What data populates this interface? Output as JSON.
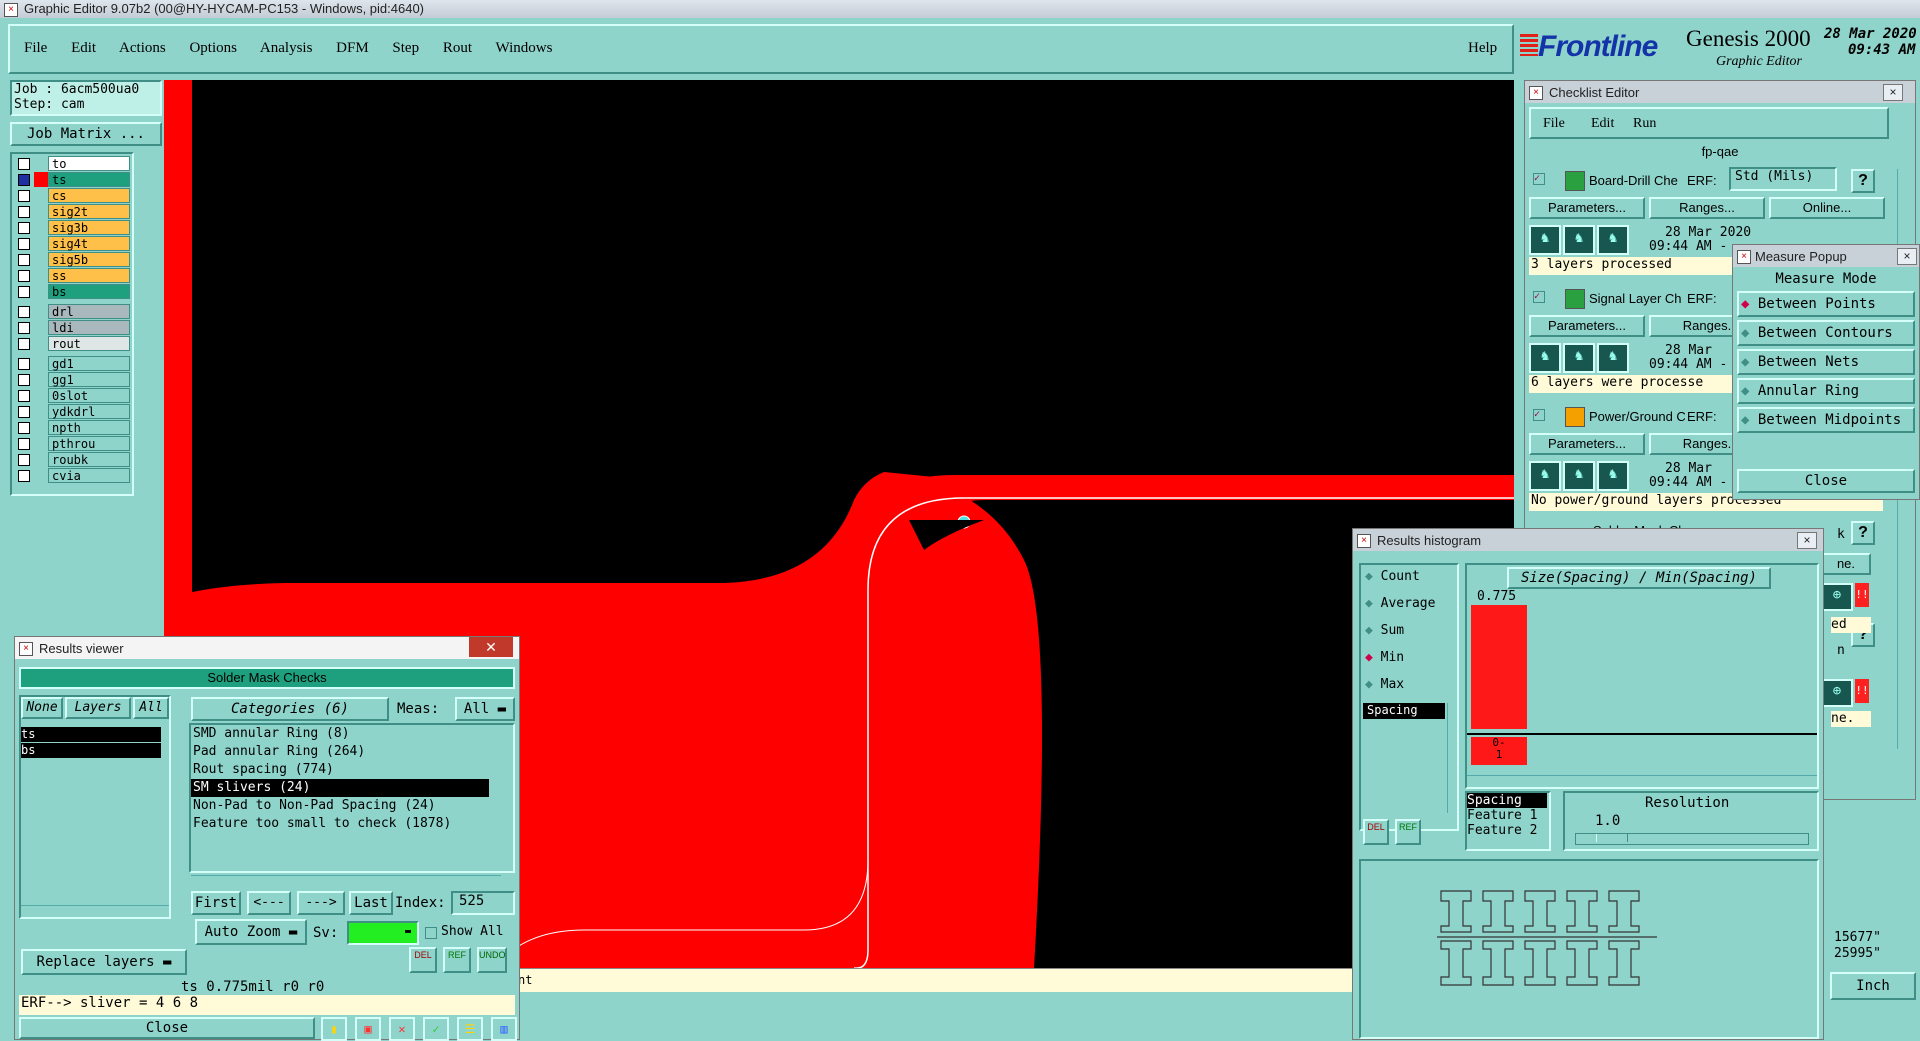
{
  "window": {
    "title": "Graphic Editor 9.07b2 (00@HY-HYCAM-PC153 - Windows, pid:4640)"
  },
  "menubar": {
    "items": [
      "File",
      "Edit",
      "Actions",
      "Options",
      "Analysis",
      "DFM",
      "Step",
      "Rout",
      "Windows"
    ],
    "help": "Help"
  },
  "brand": {
    "logo": "Frontline",
    "product": "Genesis 2000",
    "subtitle": "Graphic Editor",
    "date": "28 Mar 2020",
    "time": "09:43 AM"
  },
  "job": {
    "job_label": "Job : 6acm500ua0",
    "step_label": "Step: cam",
    "matrix_button": "Job Matrix ..."
  },
  "layers": [
    {
      "name": "to",
      "color": "#ffffff"
    },
    {
      "name": "ts",
      "color": "#1ea07e",
      "active": true
    },
    {
      "name": "cs",
      "color": "#ffc04a"
    },
    {
      "name": "sig2t",
      "color": "#ffc04a"
    },
    {
      "name": "sig3b",
      "color": "#ffc04a"
    },
    {
      "name": "sig4t",
      "color": "#ffc04a"
    },
    {
      "name": "sig5b",
      "color": "#ffc04a"
    },
    {
      "name": "ss",
      "color": "#ffc04a"
    },
    {
      "name": "bs",
      "color": "#1ea07e"
    },
    {
      "name": "drl",
      "color": "#a8b8bc"
    },
    {
      "name": "ldi",
      "color": "#a8b8bc"
    },
    {
      "name": "rout",
      "color": "#dfe6e6"
    },
    {
      "name": "gd1",
      "color": "#8fd4cb"
    },
    {
      "name": "gg1",
      "color": "#8fd4cb"
    },
    {
      "name": "0slot",
      "color": "#8fd4cb"
    },
    {
      "name": "ydkdrl",
      "color": "#8fd4cb"
    },
    {
      "name": "npth",
      "color": "#8fd4cb"
    },
    {
      "name": "pthrou",
      "color": "#8fd4cb"
    },
    {
      "name": "roubk",
      "color": "#8fd4cb"
    },
    {
      "name": "cvia",
      "color": "#8fd4cb"
    }
  ],
  "results_viewer": {
    "title": "Results viewer",
    "heading": "Solder Mask Checks",
    "tabs": {
      "none": "None",
      "layers": "Layers",
      "all": "All"
    },
    "categories_label": "Categories (6)",
    "meas_label": "Meas:",
    "meas_value": "All",
    "layer_list": [
      "ts",
      "bs"
    ],
    "categories": [
      "SMD annular Ring (8)",
      "Pad annular Ring (264)",
      "Rout spacing (774)",
      "SM slivers (24)",
      "Non-Pad to Non-Pad Spacing (24)",
      "Feature too small to check (1878)"
    ],
    "selected_category": 3,
    "nav": {
      "first": "First",
      "prev": "<---",
      "next": "--->",
      "last": "Last",
      "index_label": "Index:",
      "index_value": "525"
    },
    "auto_zoom": "Auto Zoom",
    "sv_label": "Sv:",
    "show_all": "Show All",
    "replace_layers": "Replace layers",
    "small_buttons": [
      "DEL",
      "REF",
      "UNDO"
    ],
    "status_line": "ts 0.775mil  r0  r0",
    "erf_line": "ERF--> sliver = 4 6 8",
    "close": "Close"
  },
  "checklist_editor": {
    "title": "Checklist Editor",
    "menu": [
      "File",
      "Edit",
      "Run"
    ],
    "name": "fp-qae",
    "erf_label": "ERF:",
    "erf_value": "Std (Mils)",
    "help": "?",
    "checks": [
      {
        "name": "Board-Drill Che",
        "params": "Parameters...",
        "ranges": "Ranges...",
        "online": "Online...",
        "date": "28 Mar 2020",
        "time": "09:44 AM -",
        "status": "3 layers processed"
      },
      {
        "name": "Signal Layer Ch",
        "params": "Parameters...",
        "ranges": "Ranges.",
        "date": "28 Mar",
        "time": "09:44 AM -",
        "status": "6 layers were processe"
      },
      {
        "name": "Power/Ground C",
        "params": "Parameters...",
        "ranges": "Ranges.",
        "date": "28 Mar",
        "time": "09:44 AM -",
        "status": "No power/ground layers processed"
      }
    ],
    "fourth_check": "Solder Mask Ch",
    "partial_labels": [
      "k",
      "ne.",
      "ed",
      "n",
      "ne."
    ]
  },
  "measure_popup": {
    "title": "Measure Popup",
    "heading": "Measure Mode",
    "modes": [
      "Between Points",
      "Between Contours",
      "Between Nets",
      "Annular Ring",
      "Between Midpoints"
    ],
    "selected": 0,
    "close": "Close"
  },
  "histogram": {
    "title": "Results histogram",
    "stats": [
      "Count",
      "Average",
      "Sum",
      "Min",
      "Max"
    ],
    "selected_stat": 3,
    "list_item": "Spacing",
    "chart_title": "Size(Spacing) / Min(Spacing)",
    "bar_value": "0.775",
    "bin_label": "0-1",
    "bin_label_lines": [
      "0-",
      "1"
    ],
    "bottom_list": [
      "Spacing",
      "Feature 1",
      "Feature 2"
    ],
    "resolution_label": "Resolution",
    "resolution_value": "1.0",
    "buttons": [
      "DEL",
      "REF"
    ]
  },
  "canvas": {
    "bottom_text": "nt"
  },
  "coords": {
    "x": "15677\"",
    "y": "25995\"",
    "unit": "Inch"
  }
}
